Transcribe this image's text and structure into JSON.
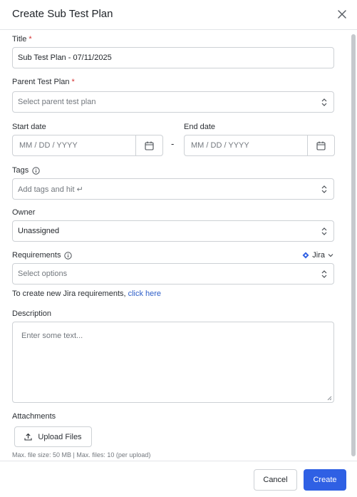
{
  "dialog": {
    "title": "Create Sub Test Plan"
  },
  "form": {
    "title": {
      "label": "Title",
      "required_mark": "*",
      "value": "Sub Test Plan - 07/11/2025"
    },
    "parent": {
      "label": "Parent Test Plan",
      "required_mark": "*",
      "placeholder": "Select parent test plan"
    },
    "start_date": {
      "label": "Start date",
      "placeholder": "MM / DD / YYYY"
    },
    "end_date": {
      "label": "End date",
      "placeholder": "MM / DD / YYYY"
    },
    "date_separator": "-",
    "tags": {
      "label": "Tags",
      "placeholder": "Add tags and hit ↵"
    },
    "owner": {
      "label": "Owner",
      "value": "Unassigned"
    },
    "requirements": {
      "label": "Requirements",
      "source": "Jira",
      "placeholder": "Select options"
    },
    "helper": {
      "text": "To create new Jira requirements,",
      "link": "click here"
    },
    "description": {
      "label": "Description",
      "placeholder": "Enter some text..."
    },
    "attachments": {
      "label": "Attachments",
      "button": "Upload Files",
      "note": "Max. file size: 50 MB | Max. files: 10 (per upload)"
    }
  },
  "footer": {
    "cancel": "Cancel",
    "create": "Create"
  },
  "colors": {
    "primary": "#2f60e4",
    "link": "#2d5ec8",
    "required": "#d43131",
    "jira": "#2f60e4"
  }
}
